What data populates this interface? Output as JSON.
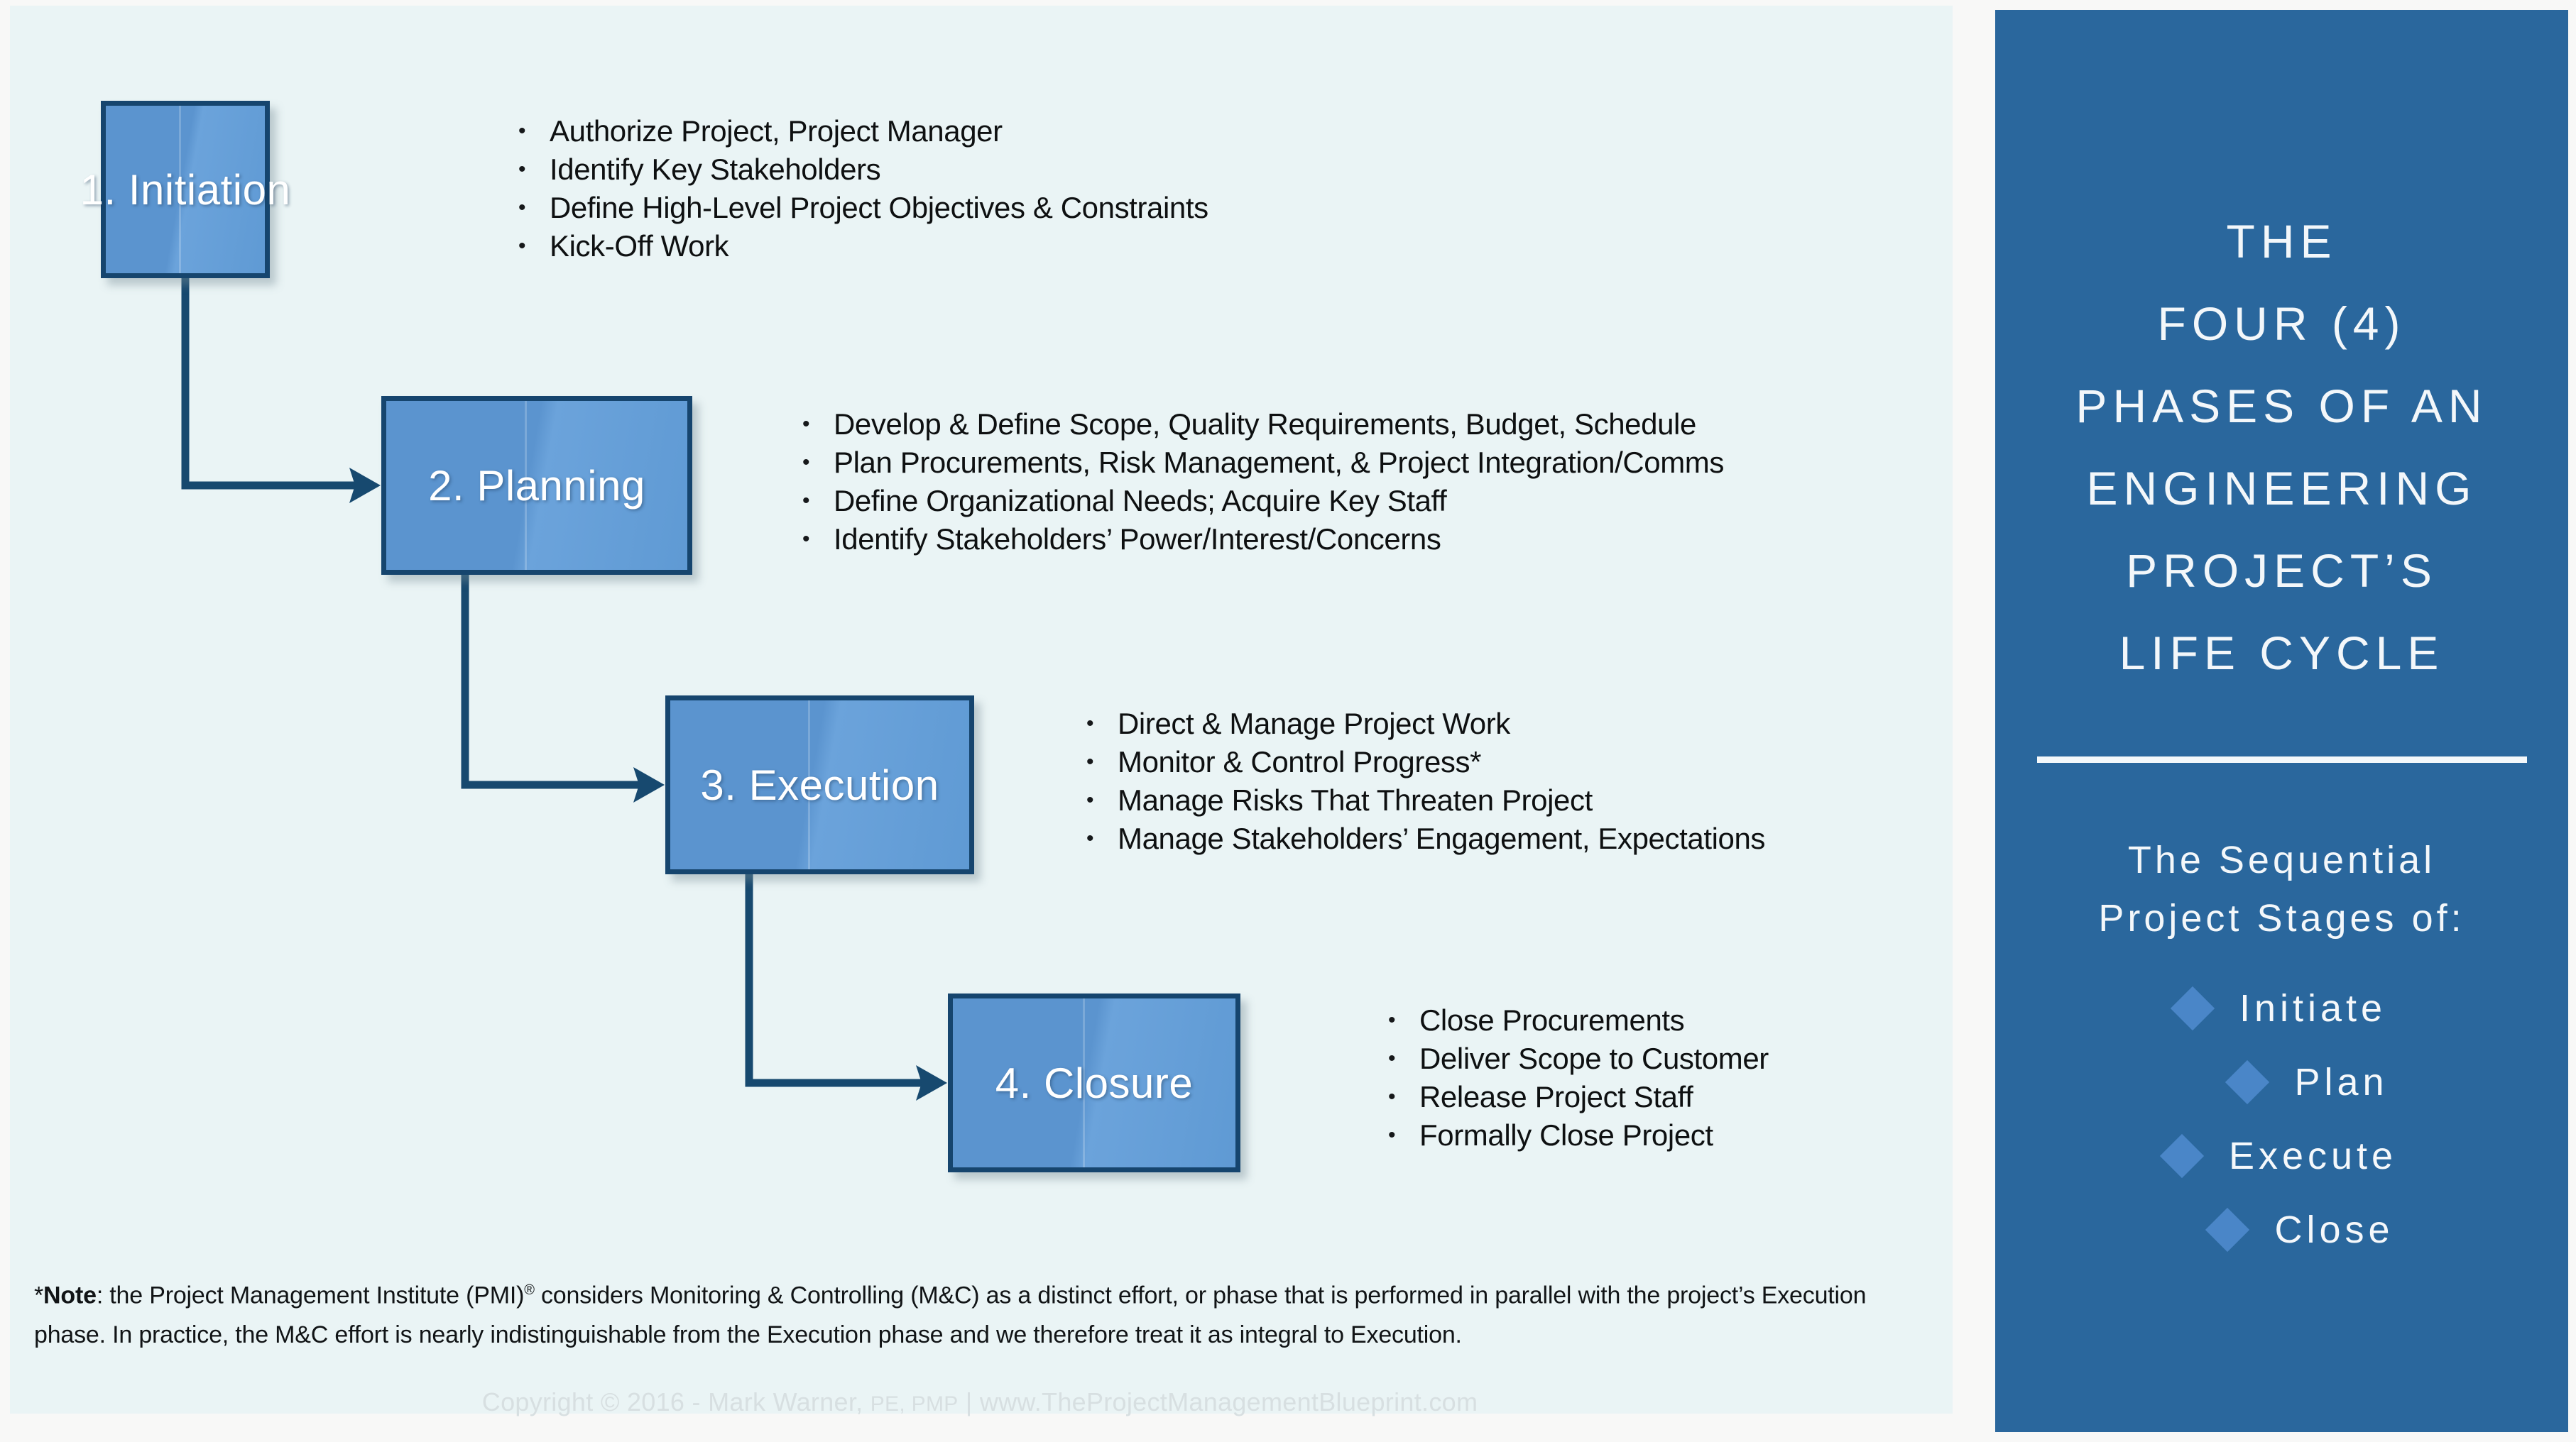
{
  "colors": {
    "panel_light": "#eaf4f5",
    "panel_blue": "#2a679d",
    "box_fill": "#5b94cf",
    "box_border": "#16456e",
    "diamond": "#4a86c8",
    "page_bg": "#f8f8f7"
  },
  "phases": [
    {
      "label": "1. Initiation",
      "bullets": [
        "Authorize Project, Project Manager",
        "Identify Key Stakeholders",
        "Define High-Level Project Objectives & Constraints",
        "Kick-Off Work"
      ]
    },
    {
      "label": "2. Planning",
      "bullets": [
        "Develop & Define Scope, Quality Requirements, Budget, Schedule",
        "Plan Procurements, Risk Management, & Project Integration/Comms",
        "Define Organizational Needs; Acquire Key Staff",
        "Identify Stakeholders’ Power/Interest/Concerns"
      ]
    },
    {
      "label": "3. Execution",
      "bullets": [
        "Direct & Manage Project Work",
        "Monitor & Control Progress*",
        "Manage Risks That Threaten Project",
        "Manage Stakeholders’ Engagement, Expectations"
      ]
    },
    {
      "label": "4. Closure",
      "bullets": [
        "Close Procurements",
        "Deliver Scope to Customer",
        "Release Project Staff",
        "Formally Close Project"
      ]
    }
  ],
  "bullet_glyph": "•",
  "footnote": {
    "marker": "*",
    "bold_lead": "Note",
    "line1_a": ": the Project Management Institute (PMI)",
    "reg": "®",
    "line1_b": " considers Monitoring & Controlling (M&C) as a distinct effort, or phase that is performed in parallel with the",
    "line2": "project’s Execution phase. In practice, the M&C effort is nearly indistinguishable from the Execution phase and we therefore treat it as integral to Execution."
  },
  "copyright": {
    "part1": "Copyright © 2016 - Mark Warner, ",
    "credentials": "PE, PMP",
    "part2": "  |  www.TheProjectManagementBlueprint.com"
  },
  "right_panel": {
    "title_lines": [
      "THE",
      "FOUR (4)",
      "PHASES OF AN",
      "ENGINEERING",
      "PROJECT’S",
      "LIFE CYCLE"
    ],
    "subtitle_lines": [
      "The Sequential",
      "Project Stages of:"
    ],
    "stages": [
      "Initiate",
      "Plan",
      "Execute",
      "Close"
    ]
  }
}
